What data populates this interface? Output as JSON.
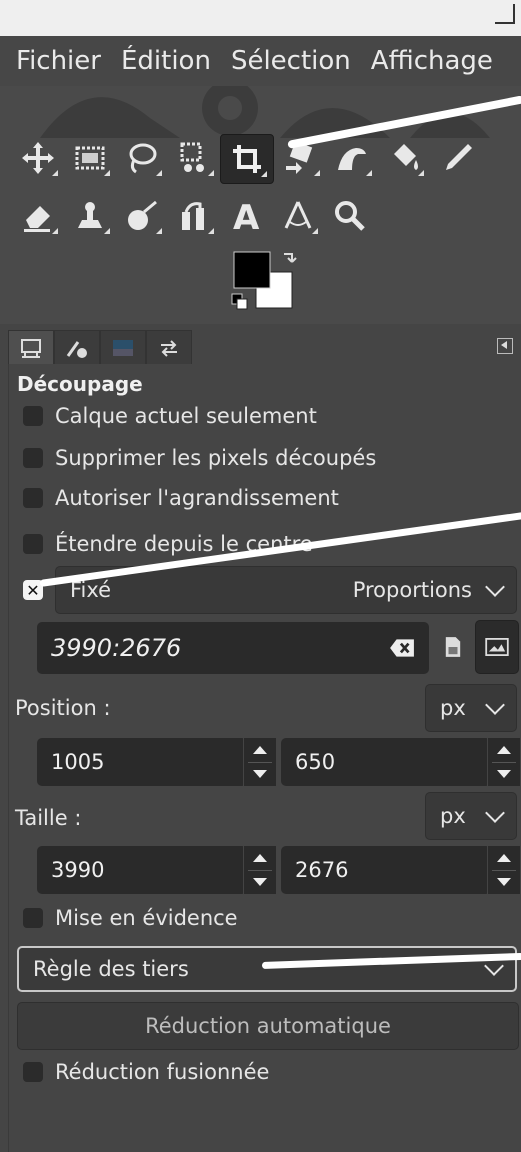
{
  "menu": {
    "items": [
      "Fichier",
      "Édition",
      "Sélection",
      "Affichage"
    ]
  },
  "icons": {
    "row1": [
      "move-icon",
      "rect-select-icon",
      "free-select-icon",
      "fuzzy-select-icon",
      "crop-icon",
      "transform-icon",
      "warp-icon",
      "bucket-fill-icon",
      "paintbrush-icon"
    ],
    "row2": [
      "eraser-icon",
      "clone-icon",
      "smudge-icon",
      "dodge-icon",
      "text-icon",
      "measure-icon",
      "zoom-icon"
    ]
  },
  "colors": {
    "foreground": "#000000",
    "background": "#ffffff",
    "annotation": "#ffffff"
  },
  "tool_options": {
    "title": "Découpage",
    "checkboxes": [
      {
        "label": "Calque actuel seulement",
        "checked": false
      },
      {
        "label": "Supprimer les pixels découpés",
        "checked": false
      },
      {
        "label": "Autoriser l'agrandissement",
        "checked": false
      },
      {
        "label": "Étendre depuis le centre",
        "checked": false
      }
    ],
    "fixed": {
      "label": "Fixé",
      "checked": true,
      "mode": "Proportions"
    },
    "ratio_value": "3990:2676",
    "position": {
      "label": "Position :",
      "unit": "px",
      "x": "1005",
      "y": "650"
    },
    "size": {
      "label": "Taille :",
      "unit": "px",
      "w": "3990",
      "h": "2676"
    },
    "highlight": {
      "label": "Mise en évidence",
      "checked": false
    },
    "guides": "Règle des tiers",
    "auto_shrink": "Réduction automatique",
    "shrink_merged": {
      "label": "Réduction fusionnée",
      "checked": false
    }
  }
}
